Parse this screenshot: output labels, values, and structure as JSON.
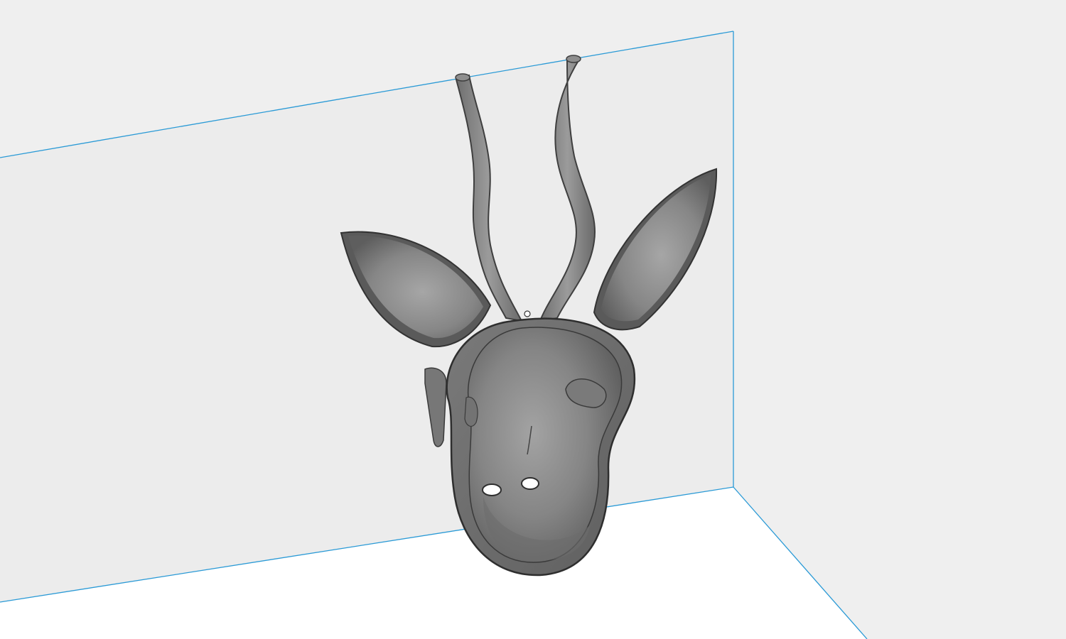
{
  "app": {
    "view": "3d-print-preview"
  },
  "scene": {
    "object": "antelope-head-wall-mount",
    "object_color": "#8a8a8a",
    "build_volume_outline_color": "#2a9ad6",
    "back_wall_color": "#ececec",
    "floor_color": "#ffffff",
    "background_color": "#efefef"
  }
}
